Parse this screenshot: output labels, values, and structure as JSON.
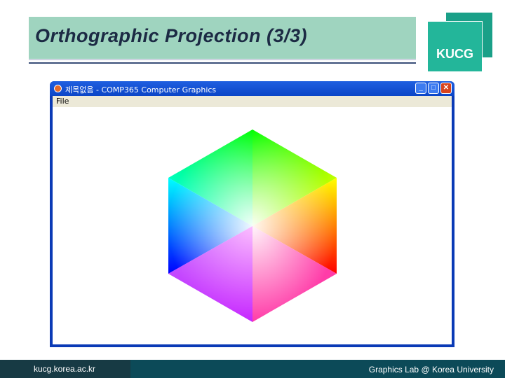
{
  "slide": {
    "title": "Orthographic Projection (3/3)",
    "logo_text": "KUCG",
    "footer_url": "kucg.korea.ac.kr",
    "footer_credit": "Graphics Lab @ Korea University"
  },
  "window": {
    "title": "제목없음 - COMP365 Computer Graphics",
    "menu": [
      "File"
    ]
  },
  "colors": {
    "title_bg": "#9fd4bf",
    "logo": "#23b69a",
    "footer": "#0c4a58",
    "window_frame": "#0a3ab6"
  }
}
